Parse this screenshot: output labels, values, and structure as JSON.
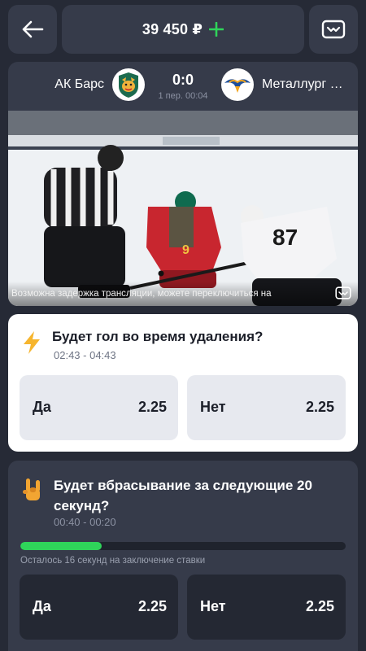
{
  "header": {
    "back_icon": "arrow-left-icon",
    "balance": "39 450 ₽",
    "add_icon": "plus-icon",
    "tv_icon": "tv-icon",
    "accent_color": "#2fd45a"
  },
  "match": {
    "home_team": "АК Барс",
    "home_logo_icon": "ak-bars-leopard-logo",
    "score": "0:0",
    "period": "1 пер. 00:04",
    "away_team": "Металлург М...",
    "away_logo_icon": "metallurg-eagle-logo",
    "stream_notice": "Возможна задержка трансляции, можете переключиться на"
  },
  "bets": [
    {
      "icon": "lightning-icon",
      "title": "Будет гол во время удаления?",
      "time": "02:43 - 04:43",
      "options": [
        {
          "label": "Да",
          "odds": "2.25"
        },
        {
          "label": "Нет",
          "odds": "2.25"
        }
      ]
    },
    {
      "icon": "rock-hand-icon",
      "title": "Будет вбрасывание за следующие 20 секунд?",
      "time": "00:40 - 00:20",
      "progress": 0.25,
      "remaining_text": "Осталось 16 секунд на заключение ставки",
      "options": [
        {
          "label": "Да",
          "odds": "2.25"
        },
        {
          "label": "Нет",
          "odds": "2.25"
        }
      ]
    }
  ]
}
